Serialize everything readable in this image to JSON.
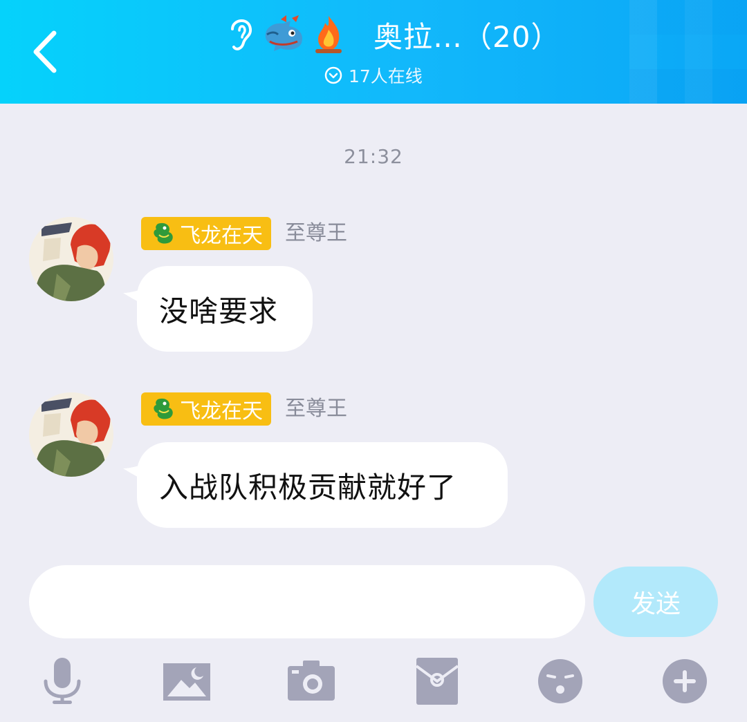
{
  "header": {
    "title": "奥拉…（20）",
    "online_count_text": "17人在线",
    "icons": [
      "back-icon",
      "ear-icon",
      "dragon-icon",
      "fire-icon",
      "online-chevron-icon"
    ]
  },
  "chat": {
    "timestamp": "21:32",
    "messages": [
      {
        "badge": "飞龙在天",
        "rank": "至尊王",
        "text": "没啥要求"
      },
      {
        "badge": "飞龙在天",
        "rank": "至尊王",
        "text": "入战队积极贡献就好了"
      }
    ]
  },
  "composer": {
    "input_value": "",
    "send_label": "发送"
  },
  "toolbar": {
    "icons": [
      "microphone-icon",
      "image-icon",
      "camera-icon",
      "red-packet-icon",
      "emoji-icon",
      "plus-icon"
    ]
  },
  "colors": {
    "header_gradient_start": "#05d2fb",
    "header_gradient_end": "#0aa7f6",
    "background": "#ededf5",
    "badge": "#f8be13",
    "send_button": "#b2e9fb",
    "icon_gray": "#a3a4b8"
  }
}
